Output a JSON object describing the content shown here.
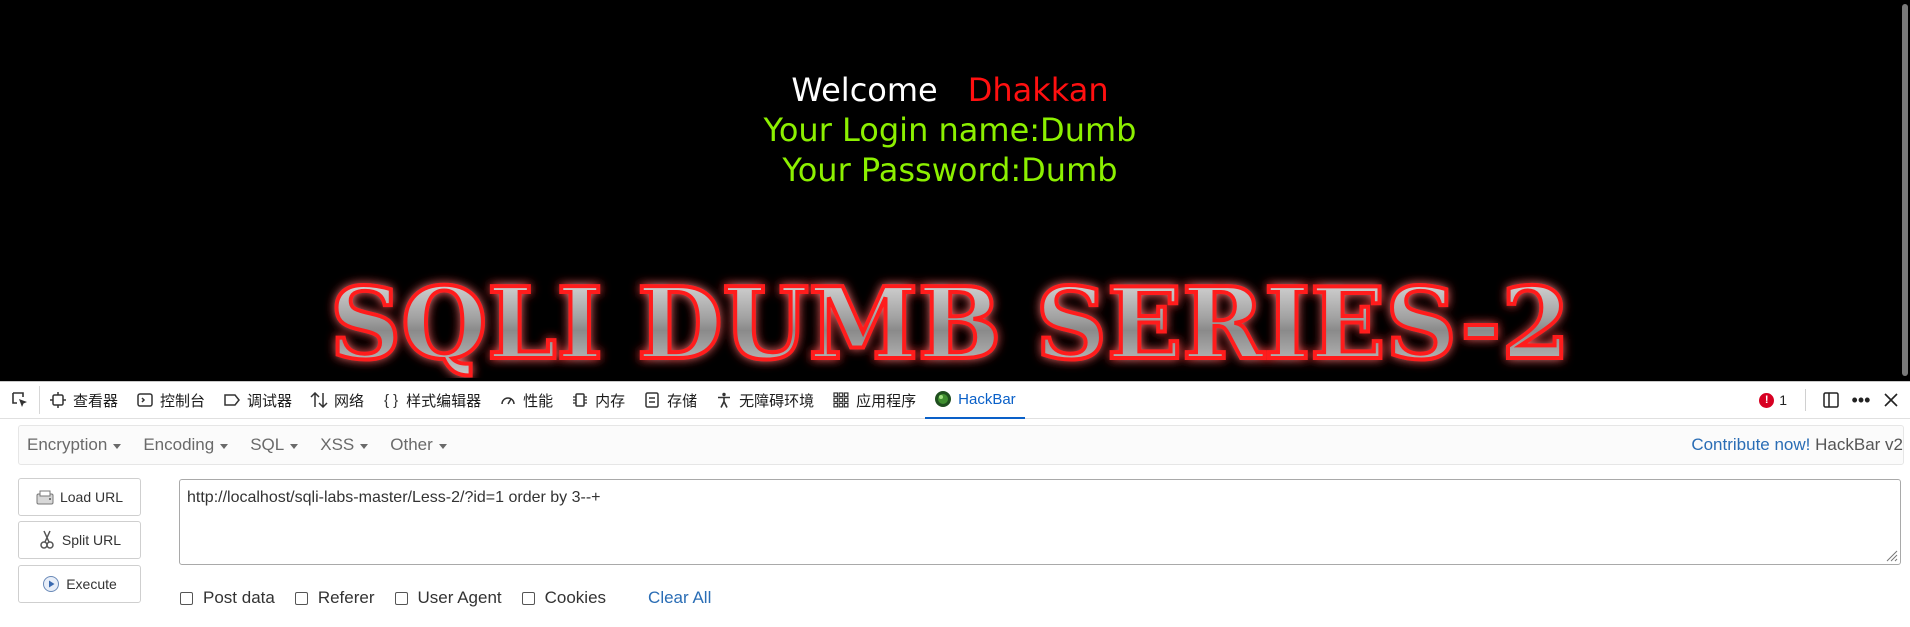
{
  "page": {
    "welcome": "Welcome",
    "welcome_name": "Dhakkan",
    "login_line": "Your Login name:Dumb",
    "password_line": "Your Password:Dumb",
    "banner_text": "SQLI DUMB SERIES-2"
  },
  "devtools": {
    "tabs": [
      {
        "label": "查看器",
        "icon": "inspector-icon"
      },
      {
        "label": "控制台",
        "icon": "console-icon"
      },
      {
        "label": "调试器",
        "icon": "debugger-icon"
      },
      {
        "label": "网络",
        "icon": "network-icon"
      },
      {
        "label": "样式编辑器",
        "icon": "style-editor-icon"
      },
      {
        "label": "性能",
        "icon": "performance-icon"
      },
      {
        "label": "内存",
        "icon": "memory-icon"
      },
      {
        "label": "存储",
        "icon": "storage-icon"
      },
      {
        "label": "无障碍环境",
        "icon": "accessibility-icon"
      },
      {
        "label": "应用程序",
        "icon": "application-icon"
      },
      {
        "label": "HackBar",
        "icon": "hackbar-icon",
        "active": true
      }
    ],
    "error_count": "1",
    "accent_color": "#0a60c8"
  },
  "hackbar": {
    "menus": [
      "Encryption",
      "Encoding",
      "SQL",
      "XSS",
      "Other"
    ],
    "contribute": "Contribute now!",
    "version": "HackBar v2",
    "buttons": {
      "load_url": "Load URL",
      "split_url": "Split URL",
      "execute": "Execute"
    },
    "url_value": "http://localhost/sqli-labs-master/Less-2/?id=1 order by 3--+",
    "options": {
      "post_data": "Post data",
      "referer": "Referer",
      "user_agent": "User Agent",
      "cookies": "Cookies"
    },
    "clear_all": "Clear All"
  }
}
